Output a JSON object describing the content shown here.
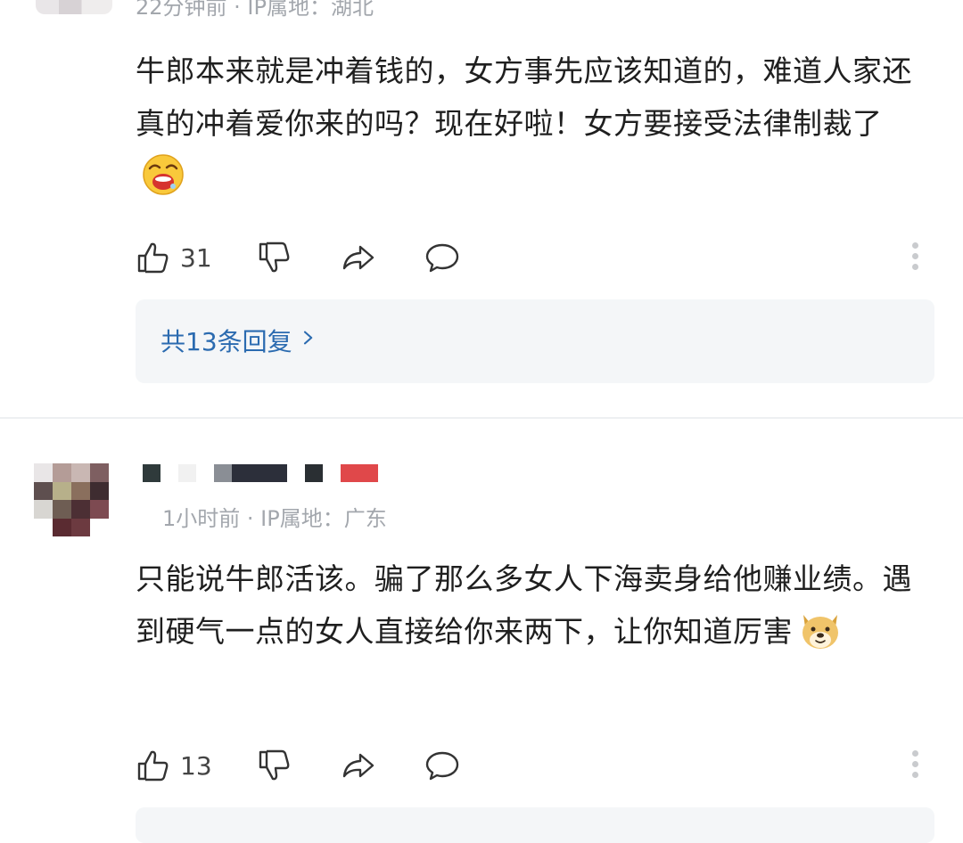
{
  "comments": [
    {
      "meta": "22分钟前 · IP属地：湖北",
      "text": "牛郎本来就是冲着钱的，女方事先应该知道的，难道人家还真的冲着爱你来的吗？现在好啦！女方要接受法律制裁了",
      "emoji": "laughing-drooling-face-icon",
      "likes": "31",
      "replies_label": "共13条回复"
    },
    {
      "meta": "1小时前 · IP属地：广东",
      "text": "只能说牛郎活该。骗了那么多女人下海卖身给他赚业绩。遇到硬气一点的女人直接给你来两下，让你知道厉害",
      "emoji": "doge-face-icon",
      "likes": "13"
    }
  ],
  "icons": {
    "like": "thumbs-up-icon",
    "dislike": "thumbs-down-icon",
    "share": "share-arrow-icon",
    "reply": "chat-bubble-icon",
    "more": "more-vertical-icon",
    "chevron": "chevron-right-icon"
  },
  "colors": {
    "link_blue": "#2b6bb0",
    "meta_gray": "#a3a7ad",
    "replies_bg": "#f4f6f8"
  }
}
